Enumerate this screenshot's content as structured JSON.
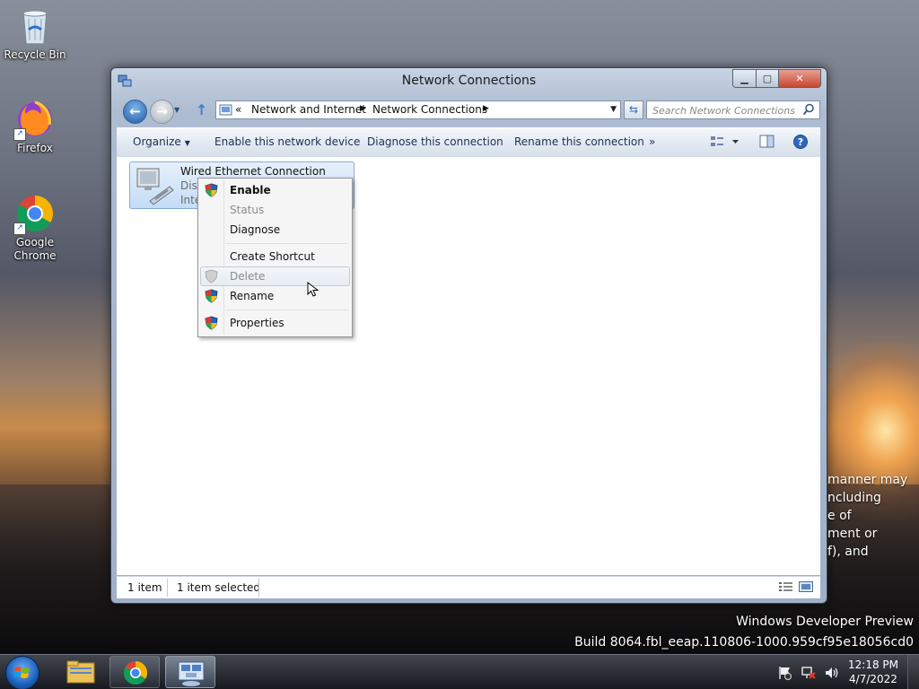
{
  "desktop": {
    "icons": [
      {
        "label": "Recycle Bin"
      },
      {
        "label": "Firefox"
      },
      {
        "label": "Google Chrome"
      }
    ],
    "watermark_line1": "Windows Developer Preview",
    "watermark_line2": "Build 8064.fbl_eeap.110806-1000.959cf95e18056cd0",
    "eula_lines": [
      "manner may",
      "ncluding",
      "e of",
      "ment or",
      "f), and"
    ]
  },
  "window": {
    "title": "Network Connections",
    "breadcrumb": {
      "overflow": "«",
      "items": [
        "Network and Internet",
        "Network Connections"
      ]
    },
    "search": {
      "placeholder": "Search Network Connections"
    },
    "commands": {
      "organize": "Organize",
      "enable": "Enable this network device",
      "diagnose": "Diagnose this connection",
      "rename": "Rename this connection",
      "more": "»"
    },
    "item": {
      "name": "Wired Ethernet Connection",
      "line2": "Disa",
      "line3": "Inte"
    },
    "status": {
      "count": "1 item",
      "selected": "1 item selected"
    }
  },
  "context_menu": {
    "items": [
      {
        "label": "Enable"
      },
      {
        "label": "Status"
      },
      {
        "label": "Diagnose"
      },
      {
        "label": "Create Shortcut"
      },
      {
        "label": "Delete"
      },
      {
        "label": "Rename"
      },
      {
        "label": "Properties"
      }
    ]
  },
  "taskbar": {
    "time": "12:18 PM",
    "date": "4/7/2022"
  },
  "colors": {
    "accent": "#1f5aa3",
    "selection": "#c4dcf6",
    "command_text": "#1e3150"
  }
}
